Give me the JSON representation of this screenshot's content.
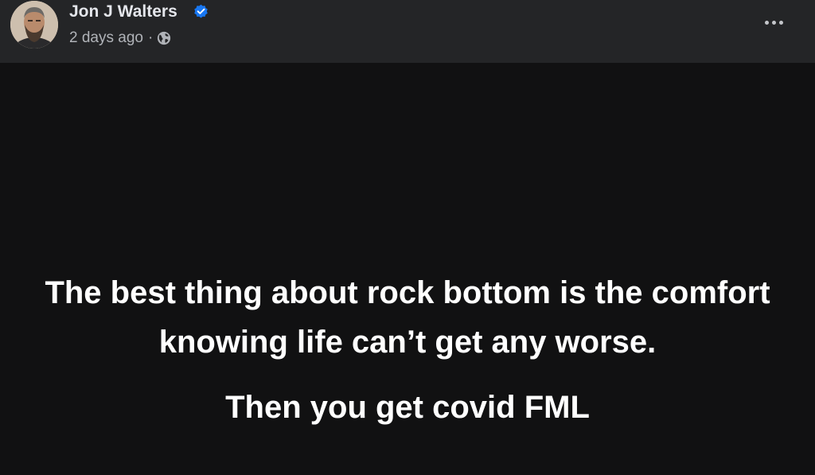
{
  "author": {
    "name": "Jon J Walters",
    "verified": true,
    "badge_color": "#1877f2"
  },
  "meta": {
    "time": "2 days ago",
    "separator": "·",
    "audience_icon": "globe-icon"
  },
  "actions": {
    "more_icon": "more-options-icon"
  },
  "post": {
    "background": "#111112",
    "text_lines": [
      "The best thing about rock bottom is the comfort knowing life can’t get any worse.",
      "Then you get covid FML"
    ]
  }
}
